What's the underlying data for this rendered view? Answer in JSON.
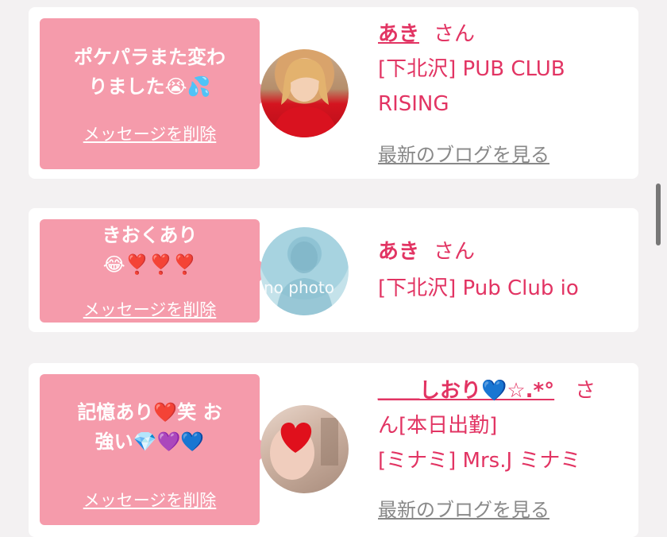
{
  "messages": [
    {
      "message_lines": [
        "ポケパラまた変わ",
        "りました😭💦"
      ],
      "delete_label": "メッセージを削除",
      "name": "あき",
      "honorific": "さん",
      "shop_line1": "[下北沢] PUB CLUB",
      "shop_line2": "RISING",
      "blog_label": "最新のブログを見る",
      "avatar": "photo-blonde-woman-red-sweater"
    },
    {
      "message_lines": [
        "きおくあり",
        "😂❣️❣️❣️"
      ],
      "delete_label": "メッセージを削除",
      "name": "あき",
      "honorific": "さん",
      "shop_line1": "[下北沢] Pub Club io",
      "avatar_text": "no photo"
    },
    {
      "message_lines": [
        "記憶あり❤️笑 お",
        "強い💎💜💙"
      ],
      "delete_label": "メッセージを削除",
      "name": "＿＿しおり💙☆.*°",
      "honorific": "さ",
      "name_line2": "ん[本日出勤]",
      "shop_line1": "[ミナミ] Mrs.J ミナミ",
      "blog_label": "最新のブログを見る",
      "avatar": "photo-woman-red-heart"
    }
  ],
  "colors": {
    "accent": "#e23463",
    "bubble": "#f59bab",
    "background": "#f3f1f2"
  }
}
